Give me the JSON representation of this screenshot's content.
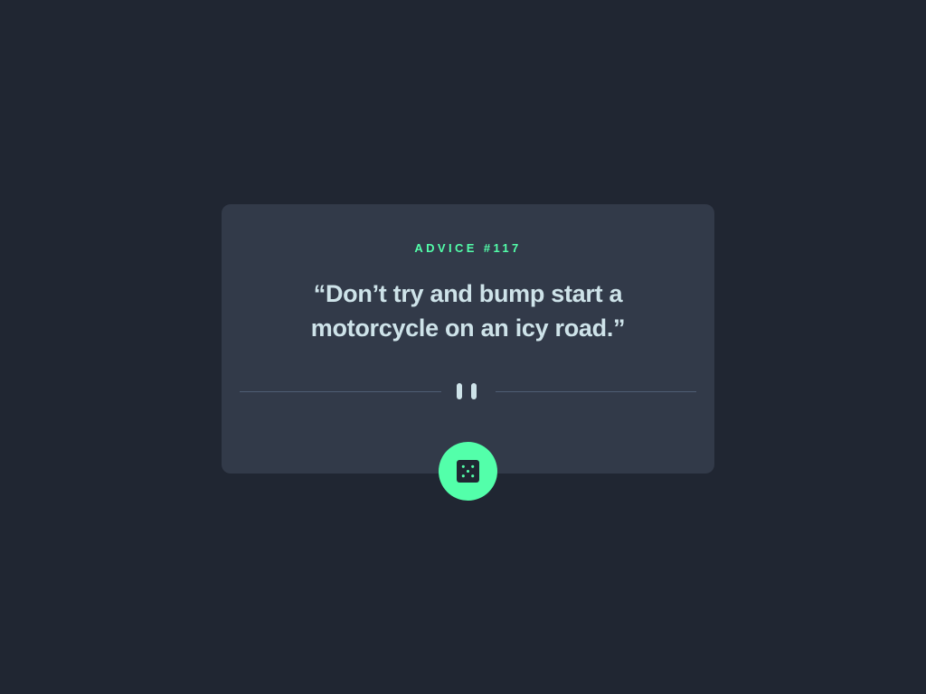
{
  "advice": {
    "id_label": "ADVICE #117",
    "quote": "“Don’t try and bump start a motorcycle on an icy road.”"
  },
  "divider": {
    "icon": "pause-icon"
  },
  "dice_button": {
    "icon": "dice-icon"
  },
  "colors": {
    "background": "#202632",
    "card": "#323a49",
    "accent": "#53ffaa",
    "text": "#cee3e9",
    "divider": "#4f5d74"
  }
}
